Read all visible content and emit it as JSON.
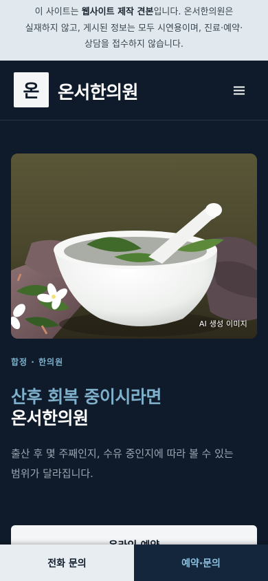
{
  "notice": {
    "line1_pre": "이 사이트는 ",
    "line1_bold": "웹사이트 제작 견본",
    "line1_post": "입니다. 온서한의원은",
    "line2": "실재하지 않고, 게시된 정보는 모두 시연용이며, 진료·예약·",
    "line3": "상담을 접수하지 않습니다."
  },
  "header": {
    "logo_char": "온",
    "brand": "온서한의원",
    "menu_icon": "hamburger-menu-icon"
  },
  "hero": {
    "image_subject": "white mortar and pestle with leaves and white flowers",
    "ai_badge": "AI 생성 이미지"
  },
  "eyebrow": "합정 · 한의원",
  "headline": {
    "line1": "산후 회복 중이시라면",
    "line2": "온서한의원"
  },
  "description": {
    "line1": "출산 후 몇 주째인지, 수유 중인지에 따라 볼 수 있는",
    "line2": "범위가 달라집니다."
  },
  "cta": {
    "online_booking": "온라인 예약"
  },
  "bottom_bar": {
    "phone": "전화 문의",
    "booking": "예약·문의"
  },
  "colors": {
    "background": "#0f1b2a",
    "accent": "#7fb0cc",
    "notice_bg": "#e2e9ee"
  }
}
